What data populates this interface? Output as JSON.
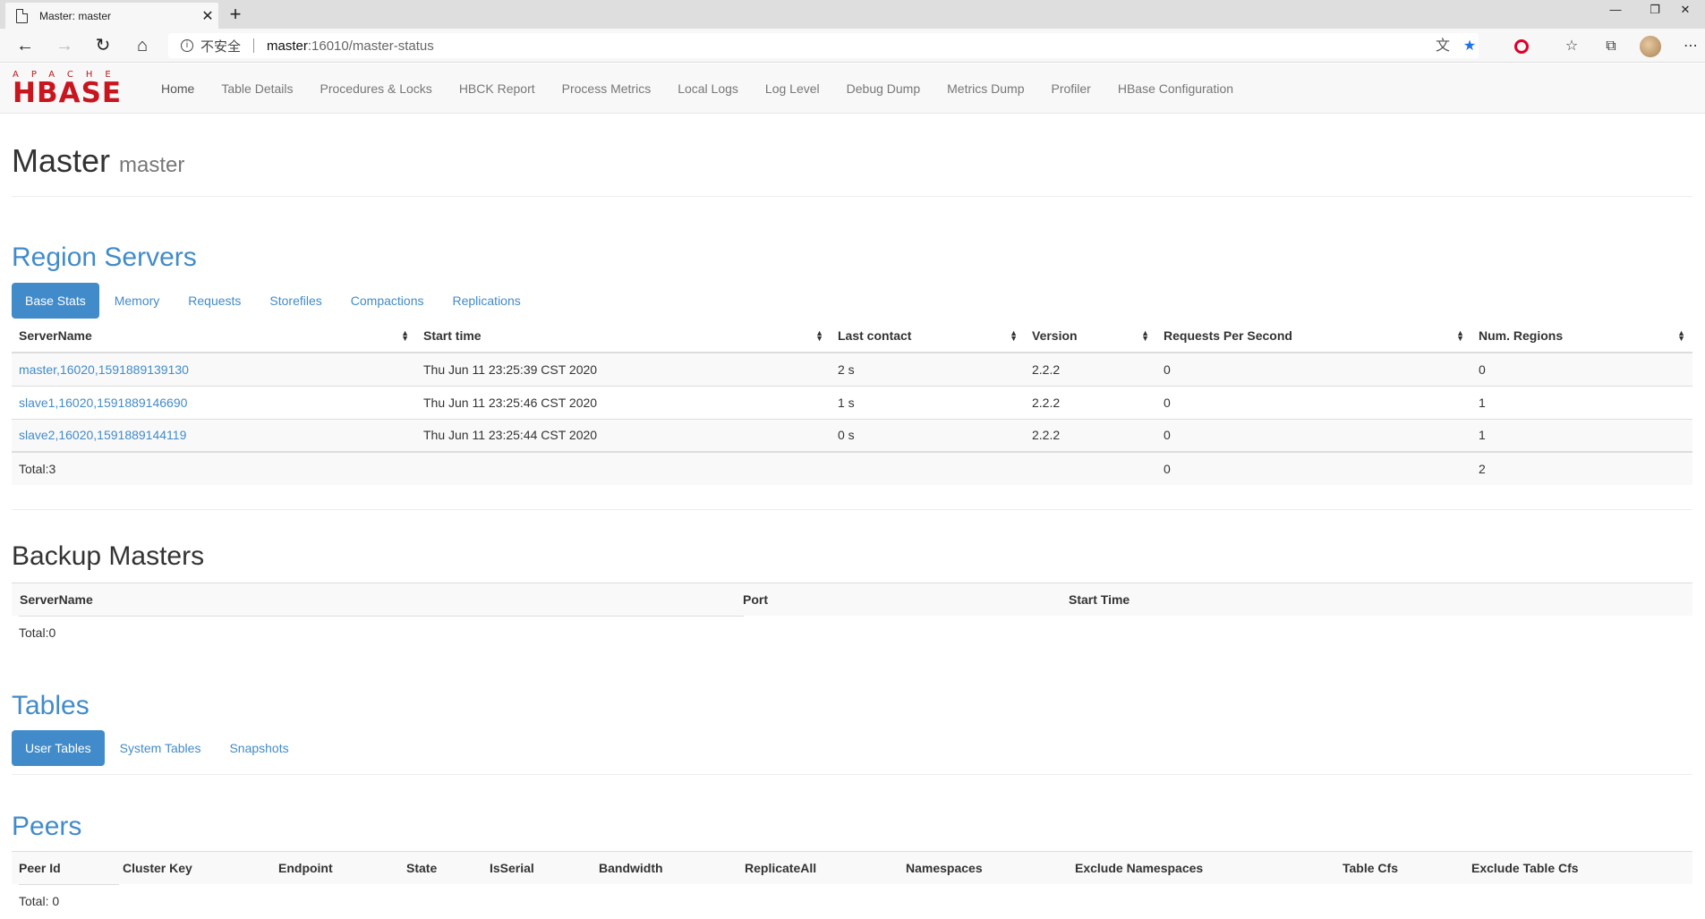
{
  "browser": {
    "tab_title": "Master: master",
    "tab_close": "✕",
    "new_tab": "+",
    "win_minimize": "—",
    "win_restore": "❐",
    "win_close": "✕",
    "insecure_label": "不安全",
    "url_host": "master",
    "url_path": ":16010/master-status",
    "icons": [
      "back-icon",
      "forward-icon",
      "refresh-icon",
      "home-icon",
      "info-icon",
      "translate-icon",
      "favorite-star-icon",
      "opera-icon",
      "favorites-list-icon",
      "collections-icon",
      "profile-avatar",
      "more-icon"
    ]
  },
  "logo": {
    "apache": "APACHE",
    "hbase": "HBASE"
  },
  "nav": {
    "items": [
      "Home",
      "Table Details",
      "Procedures & Locks",
      "HBCK Report",
      "Process Metrics",
      "Local Logs",
      "Log Level",
      "Debug Dump",
      "Metrics Dump",
      "Profiler",
      "HBase Configuration"
    ]
  },
  "header": {
    "title": "Master",
    "subtitle": "master"
  },
  "region_servers": {
    "title": "Region Servers",
    "tabs": [
      "Base Stats",
      "Memory",
      "Requests",
      "Storefiles",
      "Compactions",
      "Replications"
    ],
    "active_tab": "Base Stats",
    "columns": [
      "ServerName",
      "Start time",
      "Last contact",
      "Version",
      "Requests Per Second",
      "Num. Regions"
    ],
    "rows": [
      [
        "master,16020,1591889139130",
        "Thu Jun 11 23:25:39 CST 2020",
        "2 s",
        "2.2.2",
        "0",
        "0"
      ],
      [
        "slave1,16020,1591889146690",
        "Thu Jun 11 23:25:46 CST 2020",
        "1 s",
        "2.2.2",
        "0",
        "1"
      ],
      [
        "slave2,16020,1591889144119",
        "Thu Jun 11 23:25:44 CST 2020",
        "0 s",
        "2.2.2",
        "0",
        "1"
      ]
    ],
    "total": {
      "label": "Total:3",
      "requests": "0",
      "regions": "2"
    }
  },
  "backup_masters": {
    "title": "Backup Masters",
    "columns": [
      "ServerName",
      "Port",
      "Start Time"
    ],
    "total": "Total:0"
  },
  "tables": {
    "title": "Tables",
    "tabs": [
      "User Tables",
      "System Tables",
      "Snapshots"
    ],
    "active_tab": "User Tables"
  },
  "peers": {
    "title": "Peers",
    "columns": [
      "Peer Id",
      "Cluster Key",
      "Endpoint",
      "State",
      "IsSerial",
      "Bandwidth",
      "ReplicateAll",
      "Namespaces",
      "Exclude Namespaces",
      "Table Cfs",
      "Exclude Table Cfs"
    ],
    "total": "Total: 0"
  },
  "colors": {
    "link": "#428bca",
    "logo_red": "#c9151e"
  }
}
